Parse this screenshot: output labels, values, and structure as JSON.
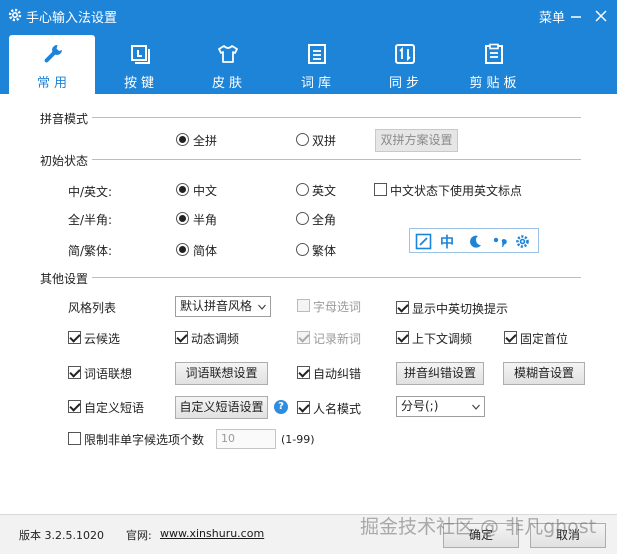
{
  "window": {
    "title": "手心输入法设置",
    "menu_label": "菜单",
    "accent_color": "#1e84d8"
  },
  "tabs": [
    {
      "label": "常用",
      "icon": "wrench-icon",
      "active": true
    },
    {
      "label": "按键",
      "icon": "keyboard-key-icon",
      "active": false
    },
    {
      "label": "皮肤",
      "icon": "shirt-icon",
      "active": false
    },
    {
      "label": "词库",
      "icon": "lexicon-icon",
      "active": false
    },
    {
      "label": "同步",
      "icon": "sync-icon",
      "active": false
    },
    {
      "label": "剪贴板",
      "icon": "clipboard-icon",
      "active": false
    }
  ],
  "pinyin_mode": {
    "section_label": "拼音模式",
    "full_pinyin": "全拼",
    "double_pinyin": "双拼",
    "double_scheme_button": "双拼方案设置",
    "selected": "全拼"
  },
  "initial_state": {
    "section_label": "初始状态",
    "cn_en": {
      "label": "中/英文:",
      "opt1": "中文",
      "opt2": "英文",
      "selected": "中文"
    },
    "cn_state_en_punct": {
      "label": "中文状态下使用英文标点",
      "checked": false
    },
    "width": {
      "label": "全/半角:",
      "opt1": "半角",
      "opt2": "全角",
      "selected": "半角"
    },
    "script": {
      "label": "简/繁体:",
      "opt1": "简体",
      "opt2": "繁体",
      "selected": "简体"
    },
    "status_icons": [
      "keyboard-pen-icon",
      "chinese-mode-icon",
      "half-width-moon-icon",
      "punctuation-icon",
      "gear-icon"
    ],
    "status_chinese_char": "中"
  },
  "other": {
    "section_label": "其他设置",
    "style_list_label": "风格列表",
    "style_select_value": "默认拼音风格",
    "letter_select": {
      "label": "字母选词",
      "checked": false,
      "disabled": true
    },
    "show_switch_hint": {
      "label": "显示中英切换提示",
      "checked": true
    },
    "cloud_candidates": {
      "label": "云候选",
      "checked": true
    },
    "dynamic_freq": {
      "label": "动态调频",
      "checked": true
    },
    "record_new_words": {
      "label": "记录新词",
      "checked": true,
      "disabled": true
    },
    "context_freq": {
      "label": "上下文调频",
      "checked": true
    },
    "fixed_first": {
      "label": "固定首位",
      "checked": true
    },
    "word_assoc": {
      "label": "词语联想",
      "checked": true
    },
    "word_assoc_button": "词语联想设置",
    "auto_correct": {
      "label": "自动纠错",
      "checked": true
    },
    "pinyin_correct_button": "拼音纠错设置",
    "fuzzy_button": "模糊音设置",
    "custom_phrase": {
      "label": "自定义短语",
      "checked": true
    },
    "custom_phrase_button": "自定义短语设置",
    "help_glyph": "?",
    "name_mode": {
      "label": "人名模式",
      "checked": true
    },
    "name_mode_select": "分号(;)",
    "limit_non_single": {
      "label": "限制非单字候选项个数",
      "checked": false
    },
    "limit_value": "10",
    "limit_range": "(1-99)"
  },
  "footer": {
    "version": "版本 3.2.5.1020",
    "website_label": "官网:",
    "website": "www.xinshuru.com",
    "ok_button": "确定",
    "cancel_button": "取消",
    "watermark": "掘金技术社区 @ 非凡ghost"
  }
}
